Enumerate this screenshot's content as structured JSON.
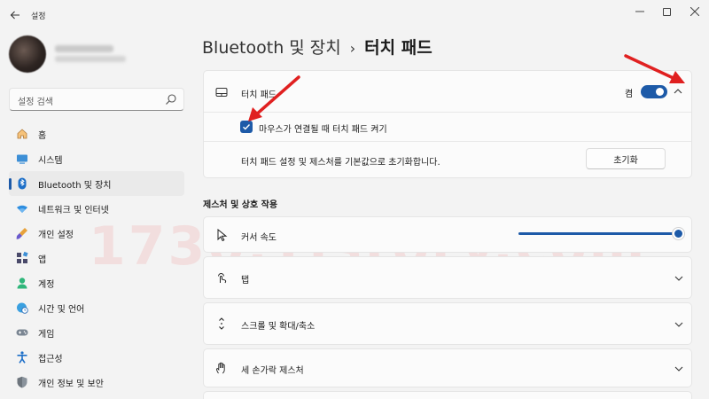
{
  "window": {
    "title": "설정",
    "back_icon": "back-arrow-icon",
    "minimize_icon": "minimize-icon",
    "maximize_icon": "maximize-icon",
    "close_icon": "close-icon"
  },
  "search": {
    "placeholder": "설정 검색",
    "icon": "search-icon"
  },
  "sidebar": {
    "items": [
      {
        "label": "홈",
        "icon": "home-icon"
      },
      {
        "label": "시스템",
        "icon": "system-icon"
      },
      {
        "label": "Bluetooth 및 장치",
        "icon": "bluetooth-icon",
        "active": true
      },
      {
        "label": "네트워크 및 인터넷",
        "icon": "wifi-icon"
      },
      {
        "label": "개인 설정",
        "icon": "paint-brush-icon"
      },
      {
        "label": "앱",
        "icon": "apps-icon"
      },
      {
        "label": "계정",
        "icon": "account-icon"
      },
      {
        "label": "시간 및 언어",
        "icon": "globe-clock-icon"
      },
      {
        "label": "게임",
        "icon": "gamepad-icon"
      },
      {
        "label": "접근성",
        "icon": "accessibility-icon"
      },
      {
        "label": "개인 정보 및 보안",
        "icon": "shield-icon"
      }
    ]
  },
  "breadcrumb": {
    "parent": "Bluetooth 및 장치",
    "separator": "›",
    "current": "터치 패드"
  },
  "touchpad": {
    "label": "터치 패드",
    "toggle_state": "켬",
    "toggle_on": true,
    "mouse_connected_label": "마우스가 연결될 때 터치 패드 켜기",
    "mouse_connected_checked": true,
    "reset_text": "터치 패드 설정 및 제스처를 기본값으로 초기화합니다.",
    "reset_button": "초기화"
  },
  "gestures": {
    "section_title": "제스처 및 상호 작용",
    "cursor_speed_label": "커서 속도",
    "cursor_speed_fraction": 1.0,
    "tap_label": "탭",
    "scroll_zoom_label": "스크롤 및 확대/축소",
    "three_finger_label": "세 손가락 제스처"
  },
  "watermark": "1730.Tistory.com",
  "colors": {
    "accent": "#1d5aa8",
    "annotation": "#e02020",
    "background": "#f3f3f3"
  }
}
